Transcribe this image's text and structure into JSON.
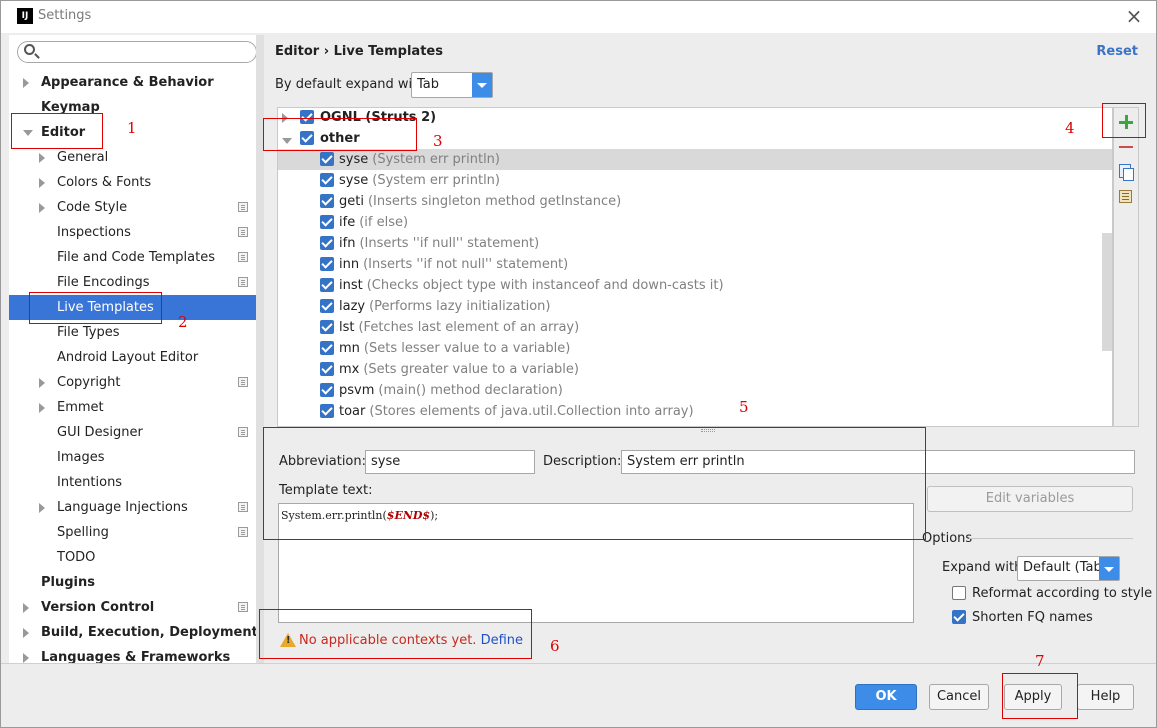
{
  "window": {
    "title": "Settings"
  },
  "search": {
    "placeholder": ""
  },
  "sidebar": {
    "items": [
      {
        "label": "Appearance & Behavior",
        "bold": true,
        "arrow": "right"
      },
      {
        "label": "Keymap",
        "bold": true
      },
      {
        "label": "Editor",
        "bold": true,
        "arrow": "down"
      },
      {
        "label": "General",
        "arrow": "right"
      },
      {
        "label": "Colors & Fonts",
        "arrow": "right"
      },
      {
        "label": "Code Style",
        "arrow": "right",
        "project": true
      },
      {
        "label": "Inspections",
        "project": true
      },
      {
        "label": "File and Code Templates",
        "project": true
      },
      {
        "label": "File Encodings",
        "project": true
      },
      {
        "label": "Live Templates",
        "selected": true
      },
      {
        "label": "File Types"
      },
      {
        "label": "Android Layout Editor"
      },
      {
        "label": "Copyright",
        "arrow": "right",
        "project": true
      },
      {
        "label": "Emmet",
        "arrow": "right"
      },
      {
        "label": "GUI Designer",
        "project": true
      },
      {
        "label": "Images"
      },
      {
        "label": "Intentions"
      },
      {
        "label": "Language Injections",
        "arrow": "right",
        "project": true
      },
      {
        "label": "Spelling",
        "project": true
      },
      {
        "label": "TODO"
      },
      {
        "label": "Plugins",
        "bold": true
      },
      {
        "label": "Version Control",
        "bold": true,
        "arrow": "right",
        "project": true
      },
      {
        "label": "Build, Execution, Deployment",
        "bold": true,
        "arrow": "right"
      },
      {
        "label": "Languages & Frameworks",
        "bold": true,
        "arrow": "right"
      }
    ]
  },
  "header": {
    "breadcrumb": "Editor › Live Templates",
    "reset": "Reset"
  },
  "expand": {
    "label": "By default expand with",
    "value": "Tab"
  },
  "templates": {
    "groups": [
      {
        "name": "OGNL (Struts 2)",
        "expanded": false
      },
      {
        "name": "other",
        "expanded": true
      }
    ],
    "items": [
      {
        "abbr": "syse",
        "desc": "(System err println)",
        "selected": true
      },
      {
        "abbr": "syse",
        "desc": "(System err println)"
      },
      {
        "abbr": "geti",
        "desc": "(Inserts singleton method getInstance)"
      },
      {
        "abbr": "ife",
        "desc": "(if else)"
      },
      {
        "abbr": "ifn",
        "desc": "(Inserts ''if null'' statement)"
      },
      {
        "abbr": "inn",
        "desc": "(Inserts ''if not null'' statement)"
      },
      {
        "abbr": "inst",
        "desc": "(Checks object type with instanceof and down-casts it)"
      },
      {
        "abbr": "lazy",
        "desc": "(Performs lazy initialization)"
      },
      {
        "abbr": "lst",
        "desc": "(Fetches last element of an array)"
      },
      {
        "abbr": "mn",
        "desc": "(Sets lesser value to a variable)"
      },
      {
        "abbr": "mx",
        "desc": "(Sets greater value to a variable)"
      },
      {
        "abbr": "psvm",
        "desc": "(main() method declaration)"
      },
      {
        "abbr": "toar",
        "desc": "(Stores elements of java.util.Collection into array)"
      }
    ]
  },
  "editor": {
    "abbreviation_label": "Abbreviation:",
    "abbreviation_value": "syse",
    "description_label": "Description:",
    "description_value": "System err println",
    "template_text_label": "Template text:",
    "template_prefix": "System.err.println(",
    "template_var": "$END$",
    "template_suffix": ");",
    "edit_variables": "Edit variables",
    "options_label": "Options",
    "expand_with_label": "Expand with",
    "expand_with_value": "Default (Tab)",
    "reformat_label": "Reformat according to style",
    "reformat_checked": false,
    "shorten_label": "Shorten FQ names",
    "shorten_checked": true,
    "warning": "No applicable contexts yet.",
    "define_link": "Define"
  },
  "buttons": {
    "ok": "OK",
    "cancel": "Cancel",
    "apply": "Apply",
    "help": "Help"
  },
  "annotations": [
    "1",
    "2",
    "3",
    "4",
    "5",
    "6",
    "7"
  ],
  "colors": {
    "accent": "#3c8ce8",
    "selection": "#3875d7",
    "annotation": "#e00000",
    "warning_text": "#c8281e"
  }
}
